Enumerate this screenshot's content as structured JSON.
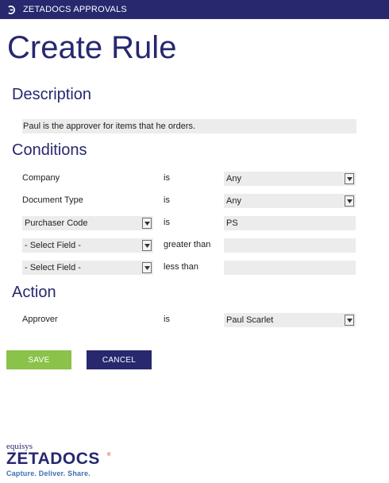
{
  "header": {
    "app_title": "ZETADOCS APPROVALS",
    "logo_icon": "zetadocs-mark-icon",
    "bar_color": "#27286e"
  },
  "page": {
    "title": "Create Rule"
  },
  "description": {
    "heading": "Description",
    "value": "Paul is the approver for items that he orders."
  },
  "conditions": {
    "heading": "Conditions",
    "rows": [
      {
        "field": "Company",
        "operator": "is",
        "value": "Any"
      },
      {
        "field": "Document Type",
        "operator": "is",
        "value": "Any"
      },
      {
        "field": "Purchaser Code",
        "operator": "is",
        "value": "PS"
      },
      {
        "field": "- Select Field -",
        "operator": "greater than",
        "value": ""
      },
      {
        "field": "- Select Field -",
        "operator": "less than",
        "value": ""
      }
    ]
  },
  "action": {
    "heading": "Action",
    "label": "Approver",
    "operator": "is",
    "value": "Paul Scarlet"
  },
  "buttons": {
    "save": "SAVE",
    "cancel": "CANCEL",
    "save_color": "#8ac24a",
    "cancel_color": "#27286e"
  },
  "brand": {
    "company": "equisys",
    "product": "ZETADOCS",
    "registered": "®",
    "tagline": "Capture. Deliver. Share."
  }
}
